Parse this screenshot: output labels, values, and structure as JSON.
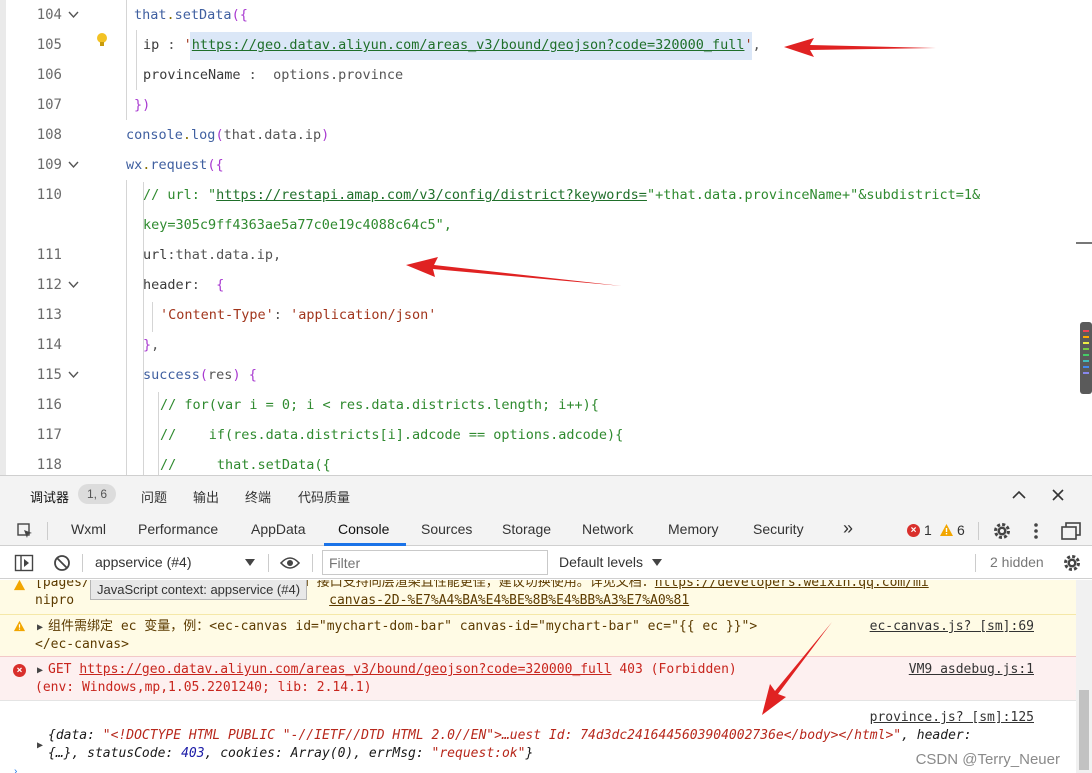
{
  "editor": {
    "lines": [
      {
        "num": "104",
        "tokens": [
          [
            "c-var",
            "that"
          ],
          [
            "c-punc",
            "."
          ],
          [
            "c-fn",
            "setData"
          ],
          [
            "c-bracket",
            "({"
          ]
        ]
      },
      {
        "num": "105",
        "tokens": [
          [
            "c-prop",
            "ip"
          ],
          [
            "c-plain",
            " : "
          ],
          [
            "c-str",
            "'"
          ],
          [
            "c-url",
            "https://geo.datav.aliyun.com/areas_v3/bound/geojson?code=320000_full"
          ],
          [
            "c-str",
            "'"
          ],
          [
            "c-plain",
            ","
          ]
        ]
      },
      {
        "num": "106",
        "tokens": [
          [
            "c-prop",
            "provinceName"
          ],
          [
            "c-plain",
            " :  "
          ],
          [
            "c-plain",
            "options.province"
          ]
        ]
      },
      {
        "num": "107",
        "tokens": [
          [
            "c-bracket",
            "})"
          ]
        ]
      },
      {
        "num": "108",
        "tokens": [
          [
            "c-var",
            "console"
          ],
          [
            "c-punc",
            "."
          ],
          [
            "c-fn",
            "log"
          ],
          [
            "c-bracket",
            "("
          ],
          [
            "c-plain",
            "that.data.ip"
          ],
          [
            "c-bracket",
            ")"
          ]
        ]
      },
      {
        "num": "109",
        "tokens": [
          [
            "c-var",
            "wx"
          ],
          [
            "c-punc",
            "."
          ],
          [
            "c-fn",
            "request"
          ],
          [
            "c-bracket",
            "({"
          ]
        ]
      },
      {
        "num": "110",
        "tokens": [
          [
            "c-cmt",
            "// url: \""
          ],
          [
            "c-url",
            "https://restapi.amap.com/v3/config/district?keywords="
          ],
          [
            "c-cmt",
            "\"+that.data.provinceName+\"&subdistrict=1&"
          ]
        ]
      },
      {
        "num": "",
        "tokens": [
          [
            "c-cmt",
            "key=305c9ff4363ae5a77c0e19c4088c64c5\","
          ]
        ]
      },
      {
        "num": "111",
        "tokens": [
          [
            "c-prop",
            "url"
          ],
          [
            "c-plain",
            ":that.data.ip,"
          ]
        ]
      },
      {
        "num": "112",
        "tokens": [
          [
            "c-prop",
            "header"
          ],
          [
            "c-plain",
            ":  "
          ],
          [
            "c-bracket",
            "{"
          ]
        ]
      },
      {
        "num": "113",
        "tokens": [
          [
            "c-str",
            "'Content-Type'"
          ],
          [
            "c-plain",
            ": "
          ],
          [
            "c-str",
            "'application/json'"
          ]
        ]
      },
      {
        "num": "114",
        "tokens": [
          [
            "c-bracket",
            "}"
          ],
          [
            "c-plain",
            ","
          ]
        ]
      },
      {
        "num": "115",
        "tokens": [
          [
            "c-fn",
            "success"
          ],
          [
            "c-bracket",
            "("
          ],
          [
            "c-plain",
            "res"
          ],
          [
            "c-bracket",
            ")"
          ],
          [
            "c-plain",
            " "
          ],
          [
            "c-bracket",
            "{"
          ]
        ]
      },
      {
        "num": "116",
        "tokens": [
          [
            "c-cmt",
            "// for(var i = 0; i < res.data.districts.length; i++){"
          ]
        ]
      },
      {
        "num": "117",
        "tokens": [
          [
            "c-cmt",
            "//    if(res.data.districts[i].adcode == options.adcode){"
          ]
        ]
      },
      {
        "num": "118",
        "tokens": [
          [
            "c-cmt",
            "//     that.setData({"
          ]
        ]
      }
    ]
  },
  "devtools": {
    "panel_tabs": {
      "debugger": "调试器",
      "badge": "1, 6",
      "problems": "问题",
      "output": "输出",
      "terminal": "终端",
      "code_quality": "代码质量"
    },
    "tool_tabs": [
      "Wxml",
      "Performance",
      "AppData",
      "Console",
      "Sources",
      "Storage",
      "Network",
      "Memory",
      "Security"
    ],
    "active_tool_tab": "Console",
    "more": "»",
    "error_count": "1",
    "warning_count": "6",
    "toolbar": {
      "context": "appservice (#4)",
      "filter_placeholder": "Filter",
      "levels": "Default levels",
      "hidden": "2 hidden"
    },
    "messages": {
      "warn1_line1": "[pages/province/province] canvas 2d 接口支持同层渲染且性能更佳，建议切换使用。详见文档：",
      "warn1_link": "https://developers.weixin.qq.com/mi",
      "warn1_line2_a": "nipro",
      "warn1_line2_b": "canvas-2D-%E7%A4%BA%E4%BE%8B%E4%BB%A3%E7%A0%81",
      "tooltip": "JavaScript context: appservice (#4)",
      "warn2_line1": "组件需绑定 ec 变量，例：<ec-canvas id=\"mychart-dom-bar\" canvas-id=\"mychart-bar\" ec=\"{{ ec }}\">",
      "warn2_line2": "</ec-canvas>",
      "warn2_src": "ec-canvas.js? [sm]:69",
      "err_method": "GET ",
      "err_url": "https://geo.datav.aliyun.com/areas_v3/bound/geojson?code=320000_full",
      "err_status": " 403 (Forbidden)",
      "err_env": "(env: Windows,mp,1.05.2201240; lib: 2.14.1)",
      "err_src": "VM9 asdebug.js:1",
      "log_src": "province.js? [sm]:125",
      "log_line1_a": "{data: ",
      "log_line1_b": "\"<!DOCTYPE HTML PUBLIC \"-//IETF//DTD HTML 2.0//EN\">…uest Id: 74d3dc2416445603904002736e</body></html>\"",
      "log_line1_c": ", header:",
      "log_line2_a": "{…}, statusCode: ",
      "log_line2_b": "403",
      "log_line2_c": ", cookies: Array(0), errMsg: ",
      "log_line2_d": "\"request:ok\"",
      "log_line2_e": "}"
    },
    "watermark": "CSDN @Terry_Neuer"
  }
}
